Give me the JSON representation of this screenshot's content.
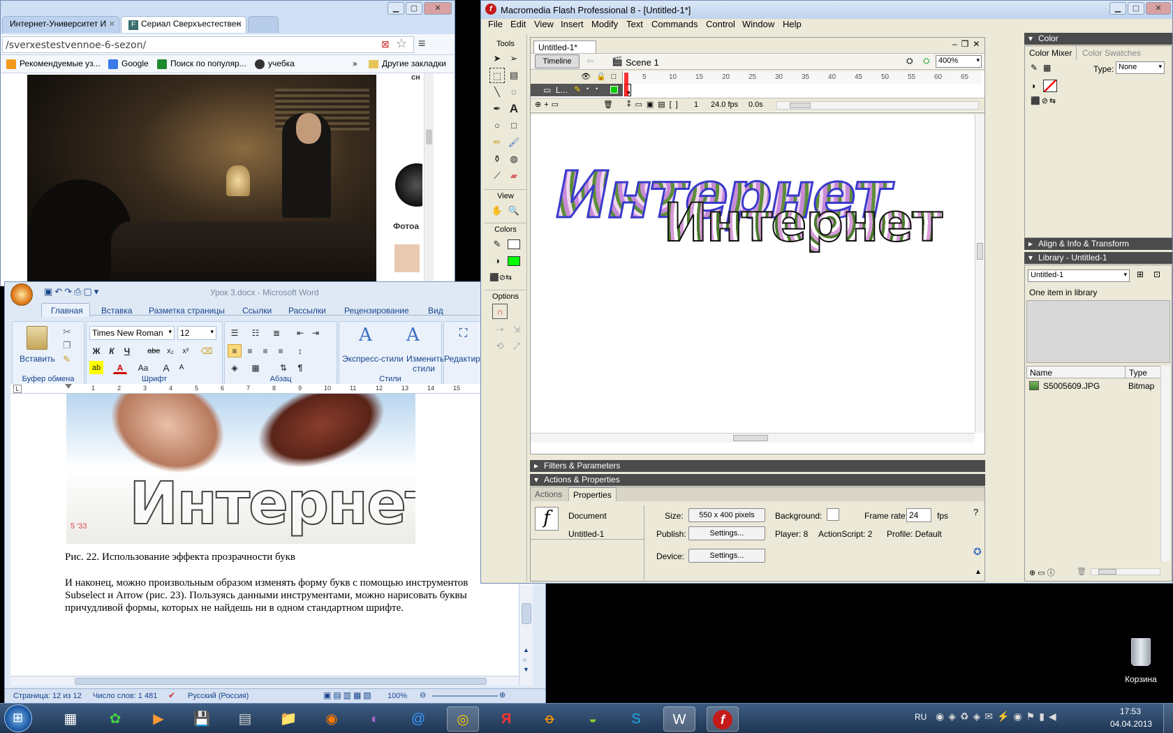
{
  "chrome": {
    "tabs": [
      {
        "label": "Интернет-Университет И"
      },
      {
        "label": "Сериал Сверхъестествен"
      }
    ],
    "url": "/sverxestestvennoe-6-sezon/",
    "bookmarks": [
      {
        "label": "Рекомендуемые уз..."
      },
      {
        "label": "Google"
      },
      {
        "label": "Поиск по популяр..."
      },
      {
        "label": "учебка"
      },
      {
        "label": "Другие закладки"
      }
    ],
    "more": "»",
    "side_text": "сн",
    "ad_text": "Фотоа"
  },
  "word": {
    "title": "Урок 3.docx - Microsoft Word",
    "ribbon_tabs": [
      "Главная",
      "Вставка",
      "Разметка страницы",
      "Ссылки",
      "Рассылки",
      "Рецензирование",
      "Вид"
    ],
    "font_name": "Times New Roman",
    "font_size": "12",
    "groups": {
      "clipboard": "Буфер обмена",
      "font": "Шрифт",
      "paragraph": "Абзац",
      "styles": "Стили"
    },
    "buttons": {
      "paste": "Вставить",
      "quick_styles": "Экспресс-стили",
      "change_styles": "Изменить стили",
      "editing": "Редактиров"
    },
    "font_buttons": {
      "bold": "Ж",
      "italic": "К",
      "underline": "Ч",
      "strike": "abe",
      "sub": "x₂",
      "sup": "x²",
      "case": "Aa",
      "grow": "A",
      "shrink": "A"
    },
    "ruler_numbers": [
      "1",
      "2",
      "3",
      "4",
      "5",
      "6",
      "7",
      "8",
      "9",
      "10",
      "11",
      "12",
      "13",
      "14",
      "15"
    ],
    "image_word": "Интернет",
    "image_stamp": "5 '33",
    "caption": "Рис. 22. Использование эффекта прозрачности букв",
    "paragraph_lines": [
      "И наконец, можно произвольным образом изменять форму букв с помощью инструментов",
      "Subselect и Arrow (рис. 23). Пользуясь данными инструментами, можно нарисовать буквы",
      "причудливой формы, которых не найдешь ни в одном стандартном шрифте."
    ],
    "status": {
      "page": "Страница: 12 из 12",
      "words": "Число слов: 1 481",
      "language": "Русский (Россия)",
      "zoom": "100%"
    }
  },
  "flash": {
    "title": "Macromedia Flash Professional 8 - [Untitled-1*]",
    "menu": [
      "File",
      "Edit",
      "View",
      "Insert",
      "Modify",
      "Text",
      "Commands",
      "Control",
      "Window",
      "Help"
    ],
    "doc_tab": "Untitled-1*",
    "timeline_btn": "Timeline",
    "scene": "Scene 1",
    "zoom": "400%",
    "layer_name": "L...",
    "frame_numbers": [
      "5",
      "10",
      "15",
      "20",
      "25",
      "30",
      "35",
      "40",
      "45",
      "50",
      "55",
      "60",
      "65"
    ],
    "frame_current": "1",
    "fps": "24.0 fps",
    "time": "0.0s",
    "tools_label": "Tools",
    "view_label": "View",
    "colors_label": "Colors",
    "options_label": "Options",
    "stage_word_1": "Интернет",
    "stage_word_2": "Интернет",
    "panels": {
      "filters": "Filters & Parameters",
      "actions_props": "Actions & Properties",
      "tab_actions": "Actions",
      "tab_properties": "Properties"
    },
    "props": {
      "doc_label": "Document",
      "doc_name": "Untitled-1",
      "size_label": "Size:",
      "size_value": "550 x 400 pixels",
      "background_label": "Background:",
      "frame_rate_label": "Frame rate:",
      "frame_rate_value": "24",
      "fps_unit": "fps",
      "publish_label": "Publish:",
      "settings": "Settings...",
      "player": "Player: 8",
      "actionscript": "ActionScript: 2",
      "profile": "Profile: Default",
      "device_label": "Device:"
    },
    "right": {
      "color": "Color",
      "mixer_tab": "Color Mixer",
      "swatches_tab": "Color Swatches",
      "type_label": "Type:",
      "type_value": "None",
      "align": "Align & Info & Transform",
      "library": "Library - Untitled-1",
      "library_select": "Untitled-1",
      "library_count": "One item in library",
      "col_name": "Name",
      "col_type": "Type",
      "item_name": "S5005609.JPG",
      "item_type": "Bitmap"
    }
  },
  "desktop": {
    "recycle": "Корзина"
  },
  "taskbar": {
    "lang": "RU",
    "time": "17:53",
    "date": "04.04.2013"
  }
}
